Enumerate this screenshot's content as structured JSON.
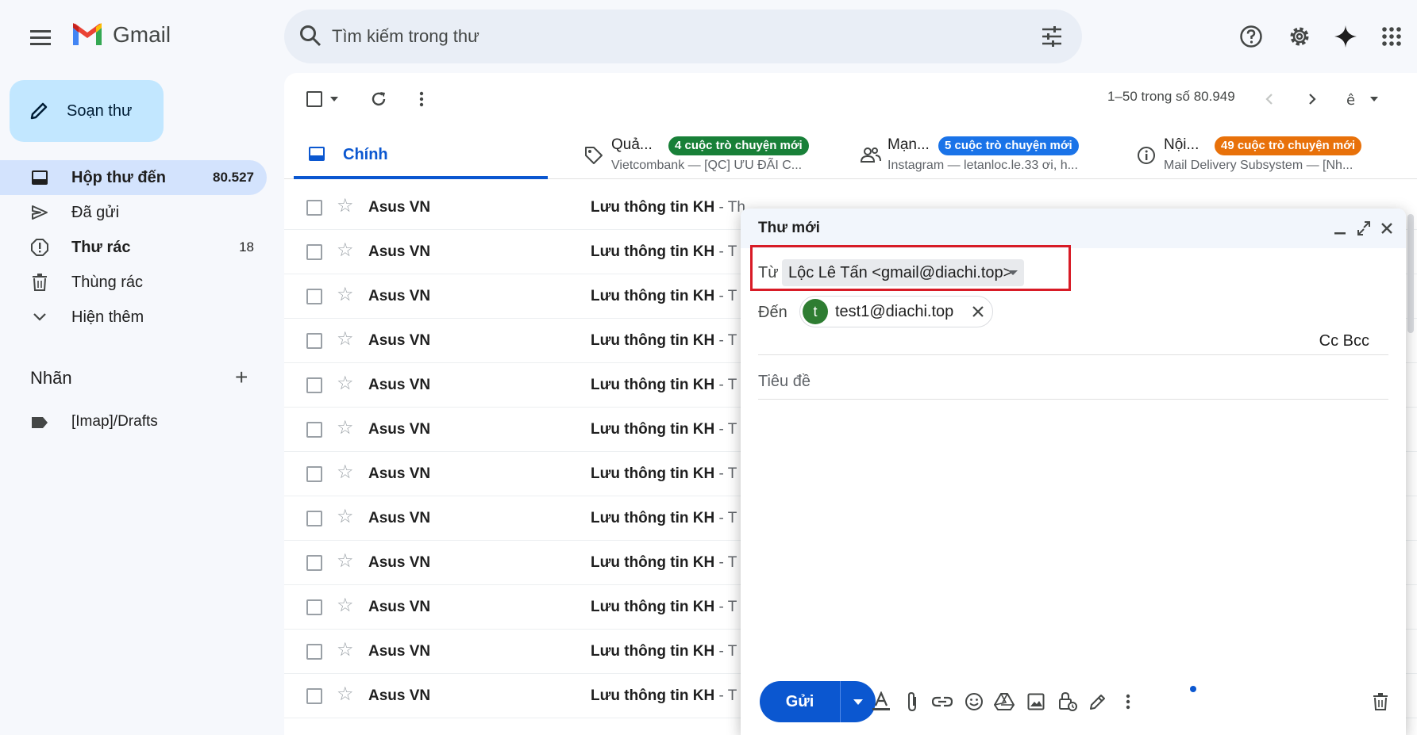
{
  "header": {
    "app_name": "Gmail",
    "search_placeholder": "Tìm kiếm trong thư"
  },
  "sidebar": {
    "compose_label": "Soạn thư",
    "items": [
      {
        "label": "Hộp thư đến",
        "count": "80.527",
        "icon": "inbox-icon"
      },
      {
        "label": "Đã gửi",
        "count": "",
        "icon": "send-icon"
      },
      {
        "label": "Thư rác",
        "count": "18",
        "icon": "spam-icon"
      },
      {
        "label": "Thùng rác",
        "count": "",
        "icon": "trash-icon"
      },
      {
        "label": "Hiện thêm",
        "count": "",
        "icon": "chevron-down-icon"
      }
    ],
    "labels_title": "Nhãn",
    "labels": [
      {
        "label": "[Imap]/Drafts",
        "icon": "label-icon"
      }
    ]
  },
  "toolbar": {
    "pagination": "1–50 trong số 80.949"
  },
  "tabs": {
    "primary": "Chính",
    "promotions": {
      "name": "Quả...",
      "badge": "4 cuộc trò chuyện mới",
      "sub": "Vietcombank — [QC] ƯU ĐÃI C...",
      "badge_color": "#188038"
    },
    "social": {
      "name": "Mạn...",
      "badge": "5 cuộc trò chuyện mới",
      "sub": "Instagram — letanloc.le.33 ơi, h...",
      "badge_color": "#1a73e8"
    },
    "updates": {
      "name": "Nội...",
      "badge": "49 cuộc trò chuyện mới",
      "sub": "Mail Delivery Subsystem — [Nh...",
      "badge_color": "#e8710a"
    }
  },
  "emails": [
    {
      "sender": "Asus VN",
      "subject": "Lưu thông tin KH",
      "snippet": " - Th"
    },
    {
      "sender": "Asus VN",
      "subject": "Lưu thông tin KH",
      "snippet": " - T"
    },
    {
      "sender": "Asus VN",
      "subject": "Lưu thông tin KH",
      "snippet": " - T"
    },
    {
      "sender": "Asus VN",
      "subject": "Lưu thông tin KH",
      "snippet": " - T"
    },
    {
      "sender": "Asus VN",
      "subject": "Lưu thông tin KH",
      "snippet": " - T"
    },
    {
      "sender": "Asus VN",
      "subject": "Lưu thông tin KH",
      "snippet": " - T"
    },
    {
      "sender": "Asus VN",
      "subject": "Lưu thông tin KH",
      "snippet": " - T"
    },
    {
      "sender": "Asus VN",
      "subject": "Lưu thông tin KH",
      "snippet": " - T"
    },
    {
      "sender": "Asus VN",
      "subject": "Lưu thông tin KH",
      "snippet": " - T"
    },
    {
      "sender": "Asus VN",
      "subject": "Lưu thông tin KH",
      "snippet": " - T"
    },
    {
      "sender": "Asus VN",
      "subject": "Lưu thông tin KH",
      "snippet": " - T"
    },
    {
      "sender": "Asus VN",
      "subject": "Lưu thông tin KH",
      "snippet": " - T"
    }
  ],
  "compose": {
    "title": "Thư mới",
    "from_label": "Từ",
    "from_value": "Lộc Lê Tấn <gmail@diachi.top>",
    "to_label": "Đến",
    "to_avatar": "t",
    "to_email": "test1@diachi.top",
    "cc_bcc": "Cc Bcc",
    "subject_placeholder": "Tiêu đề",
    "send_label": "Gửi"
  },
  "colors": {
    "accent": "#0b57d0",
    "compose_button": "#c2e7ff",
    "active_nav": "#d3e3fd",
    "highlight_box": "#d81b26"
  }
}
